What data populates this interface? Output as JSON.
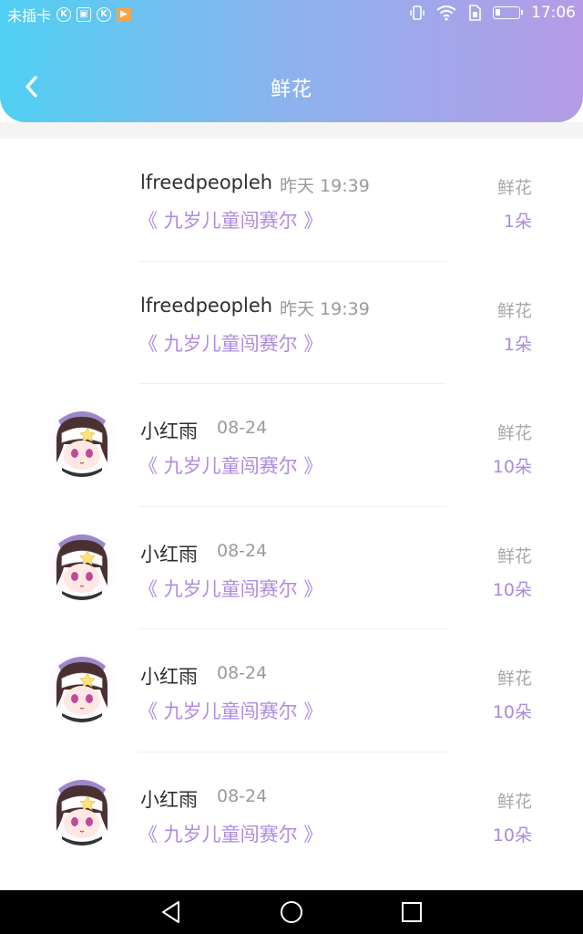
{
  "status_bar": {
    "carrier": "未插卡",
    "time": "17:06",
    "icons": [
      "k-icon",
      "image-icon",
      "k-icon",
      "play-icon",
      "vibrate-icon",
      "wifi-icon",
      "sim-icon",
      "battery-icon"
    ]
  },
  "header": {
    "title": "鲜花",
    "back_icon": "chevron-left-icon",
    "gradient": [
      "#4fd0f2",
      "#b59be6"
    ]
  },
  "colors": {
    "accent": "#b08be0",
    "name": "#2f2f2f",
    "secondary": "#9a9a9a"
  },
  "items": [
    {
      "name": "lfreedpeopleh",
      "time": "昨天 19:39",
      "work": "《 九岁儿童闯赛尔 》",
      "type": "鲜花",
      "count": "1朵",
      "has_avatar": false
    },
    {
      "name": "lfreedpeopleh",
      "time": "昨天 19:39",
      "work": "《 九岁儿童闯赛尔 》",
      "type": "鲜花",
      "count": "1朵",
      "has_avatar": false
    },
    {
      "name": "小红雨",
      "time": "08-24",
      "work": "《 九岁儿童闯赛尔 》",
      "type": "鲜花",
      "count": "10朵",
      "has_avatar": true
    },
    {
      "name": "小红雨",
      "time": "08-24",
      "work": "《 九岁儿童闯赛尔 》",
      "type": "鲜花",
      "count": "10朵",
      "has_avatar": true
    },
    {
      "name": "小红雨",
      "time": "08-24",
      "work": "《 九岁儿童闯赛尔 》",
      "type": "鲜花",
      "count": "10朵",
      "has_avatar": true
    },
    {
      "name": "小红雨",
      "time": "08-24",
      "work": "《 九岁儿童闯赛尔 》",
      "type": "鲜花",
      "count": "10朵",
      "has_avatar": true
    }
  ],
  "nav_bar": {
    "icons": [
      "back-triangle-icon",
      "home-circle-icon",
      "recents-square-icon"
    ]
  }
}
